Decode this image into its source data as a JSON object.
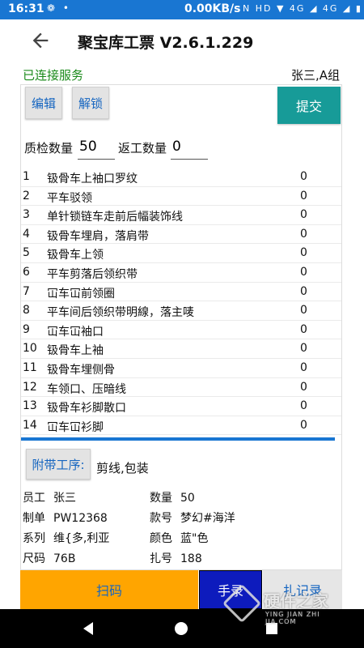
{
  "status_bar": {
    "time": "16:31",
    "left_icons": "❁ •",
    "net_speed": "0.00KB/s",
    "right_icons": "N HD ▼ 4G ◢ 4G ◢ ▮"
  },
  "header": {
    "title": "聚宝库工票 V2.6.1.229"
  },
  "connection_status": "已连接服务",
  "user_group": "张三,A组",
  "toolbar": {
    "edit_label": "编辑",
    "unlock_label": "解锁",
    "submit_label": "提交"
  },
  "quantities": {
    "qc_label": "质检数量",
    "qc_value": "50",
    "rework_label": "返工数量",
    "rework_value": "0"
  },
  "processes": [
    {
      "num": "1",
      "name": "钑骨车上袖口罗纹",
      "value": "0"
    },
    {
      "num": "2",
      "name": "平车驳领",
      "value": "0"
    },
    {
      "num": "3",
      "name": "单针锁链车走前后幅装饰线",
      "value": "0"
    },
    {
      "num": "4",
      "name": "钑骨车埋肩，落肩带",
      "value": "0"
    },
    {
      "num": "5",
      "name": "钑骨车上领",
      "value": "0"
    },
    {
      "num": "6",
      "name": "平车剪落后领织带",
      "value": "0"
    },
    {
      "num": "7",
      "name": "冚车冚前领圈",
      "value": "0"
    },
    {
      "num": "8",
      "name": "平车间后领织带明線，落主唛",
      "value": "0"
    },
    {
      "num": "9",
      "name": "冚车冚袖口",
      "value": "0"
    },
    {
      "num": "10",
      "name": "钑骨车上袖",
      "value": "0"
    },
    {
      "num": "11",
      "name": "钑骨车埋侧骨",
      "value": "0"
    },
    {
      "num": "12",
      "name": "车领口、压暗线",
      "value": "0"
    },
    {
      "num": "13",
      "name": "钑骨车衫脚散口",
      "value": "0"
    },
    {
      "num": "14",
      "name": "冚车冚衫脚",
      "value": "0"
    }
  ],
  "attached": {
    "button_label": "附带工序:",
    "value": "剪线,包装"
  },
  "info": {
    "employee_label": "员工",
    "employee": "张三",
    "quantity_label": "数量",
    "quantity": "50",
    "order_label": "制单",
    "order": "PW12368",
    "style_label": "款号",
    "style": "梦幻#海洋",
    "series_label": "系列",
    "series": "维{多,利亚",
    "color_label": "颜色",
    "color": "蓝\"色",
    "size_label": "尺码",
    "size": "76B",
    "bundle_label": "扎号",
    "bundle": "188"
  },
  "bottom_buttons": {
    "scan_label": "扫码",
    "manual_label": "手录",
    "records_label": "扎记录"
  },
  "watermark": {
    "text": "硬件之家",
    "subtext": "YING JIAN ZHI JIA.COM"
  },
  "colors": {
    "status_bar": "#1976d2",
    "connected": "#1a8a1a",
    "submit": "#179b98",
    "scan": "#ffa500",
    "manual": "#0d1bbd",
    "button_text": "#1565c0"
  }
}
